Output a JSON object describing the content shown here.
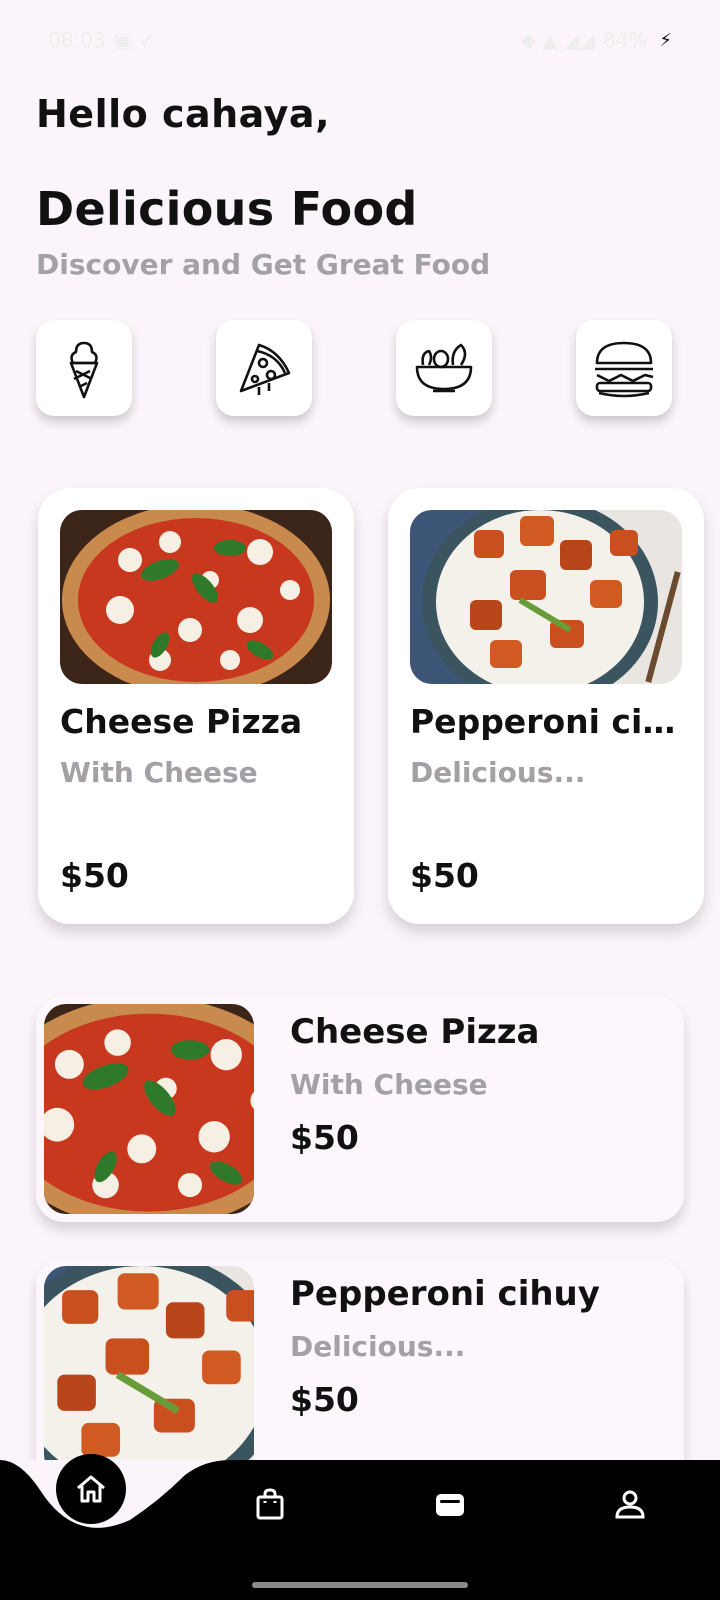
{
  "status_bar": {
    "time": "08:03",
    "battery": "84%"
  },
  "greeting": "Hello cahaya,",
  "title": "Delicious Food",
  "subtitle": "Discover and Get Great Food",
  "categories": [
    {
      "icon": "ice-cream-icon"
    },
    {
      "icon": "pizza-slice-icon"
    },
    {
      "icon": "salad-bowl-icon"
    },
    {
      "icon": "burger-icon"
    }
  ],
  "featured": [
    {
      "name": "Cheese Pizza",
      "desc": "With Cheese",
      "price": "$50",
      "image": "pizza"
    },
    {
      "name": "Pepperoni cih...",
      "desc": "Delicious...",
      "price": "$50",
      "image": "chicken-rice-bowl"
    }
  ],
  "list": [
    {
      "name": "Cheese Pizza",
      "desc": "With Cheese",
      "price": "$50",
      "image": "pizza"
    },
    {
      "name": "Pepperoni cihuy",
      "desc": "Delicious...",
      "price": "$50",
      "image": "chicken-rice-bowl"
    }
  ],
  "nav": [
    {
      "icon": "home-icon",
      "active": true
    },
    {
      "icon": "shopping-bag-icon",
      "active": false
    },
    {
      "icon": "wallet-icon",
      "active": false
    },
    {
      "icon": "profile-icon",
      "active": false
    }
  ],
  "colors": {
    "background": "#fbf4fb",
    "accent": "#000000",
    "muted_text": "#a3a0a6"
  }
}
